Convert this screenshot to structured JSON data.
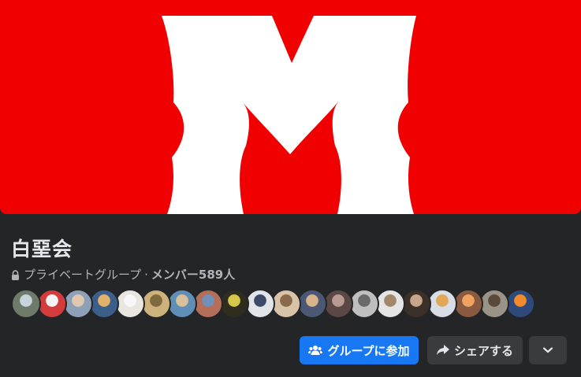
{
  "group": {
    "name": "白堊会",
    "privacy": "プライベートグループ",
    "separator": " · ",
    "members_label": "メンバー589人"
  },
  "cover": {
    "background": "#f00000",
    "letter_color": "#ffffff"
  },
  "member_avatars": [
    {
      "color": "#6e7a6a",
      "accent": "#c9d3db"
    },
    {
      "color": "#d43b3b",
      "accent": "#f4f4f4"
    },
    {
      "color": "#8ea0b8",
      "accent": "#e0c8b0"
    },
    {
      "color": "#3b5f8a",
      "accent": "#e0b26b"
    },
    {
      "color": "#e9e6df",
      "accent": "#f7f7f7"
    },
    {
      "color": "#cdb27c",
      "accent": "#7e6a3d"
    },
    {
      "color": "#5f8fb7",
      "accent": "#d9c09a"
    },
    {
      "color": "#b56f58",
      "accent": "#6f90b9"
    },
    {
      "color": "#2e2d1e",
      "accent": "#d6c64a"
    },
    {
      "color": "#e1e5ea",
      "accent": "#3c4a68"
    },
    {
      "color": "#d8c3a8",
      "accent": "#8a6a4a"
    },
    {
      "color": "#4a5775",
      "accent": "#d9b48a"
    },
    {
      "color": "#5a4746",
      "accent": "#b89b93"
    },
    {
      "color": "#bfbfbf",
      "accent": "#6a6a6a"
    },
    {
      "color": "#e5e5e5",
      "accent": "#a3876a"
    },
    {
      "color": "#3b2f2a",
      "accent": "#c7a58c"
    },
    {
      "color": "#d9dde6",
      "accent": "#e2a657"
    },
    {
      "color": "#8a5a40",
      "accent": "#f0a260"
    },
    {
      "color": "#9a9486",
      "accent": "#5a4a3a"
    },
    {
      "color": "#2f4a7a",
      "accent": "#f08a2c"
    }
  ],
  "actions": {
    "join_label": "グループに参加",
    "share_label": "シェアする"
  },
  "icons": {
    "lock": "lock-icon",
    "join": "group-icon",
    "share": "share-arrow-icon",
    "more": "chevron-down-icon"
  }
}
